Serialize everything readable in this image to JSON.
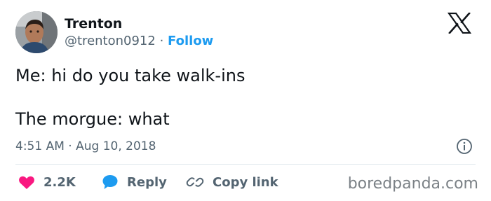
{
  "author": {
    "display_name": "Trenton",
    "handle": "@trenton0912",
    "separator": "·",
    "follow_label": "Follow"
  },
  "tweet": {
    "line1": "Me: hi do you take walk-ins",
    "line2": "The morgue: what"
  },
  "meta": {
    "time": "4:51 AM",
    "separator": "·",
    "date": "Aug 10, 2018"
  },
  "actions": {
    "likes": "2.2K",
    "reply_label": "Reply",
    "copy_link_label": "Copy link"
  },
  "watermark": "boredpanda.com",
  "icons": {
    "logo": "x-logo-icon",
    "info": "info-icon",
    "like": "heart-icon",
    "reply": "speech-bubble-icon",
    "copy": "link-icon"
  },
  "colors": {
    "text": "#0f1419",
    "secondary": "#536471",
    "link": "#1d9bf0",
    "like": "#f91880"
  }
}
